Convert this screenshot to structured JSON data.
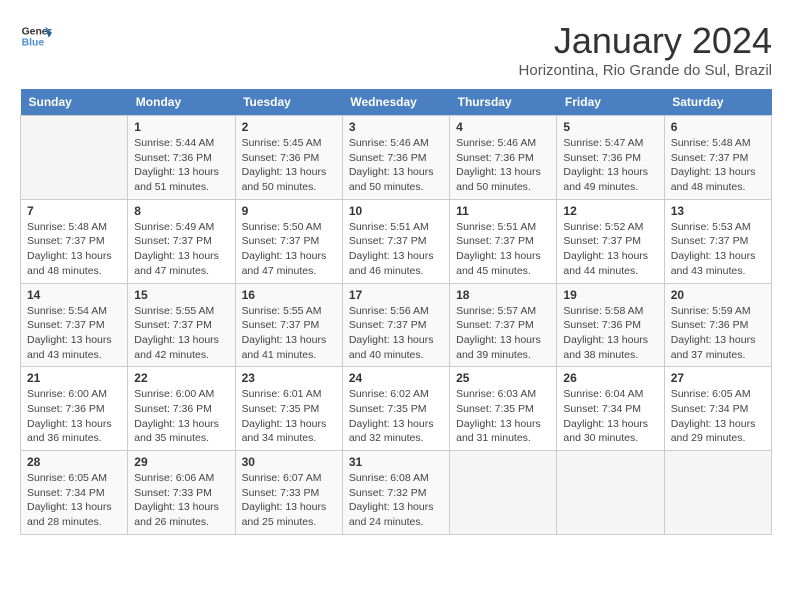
{
  "header": {
    "logo_line1": "General",
    "logo_line2": "Blue",
    "month": "January 2024",
    "location": "Horizontina, Rio Grande do Sul, Brazil"
  },
  "weekdays": [
    "Sunday",
    "Monday",
    "Tuesday",
    "Wednesday",
    "Thursday",
    "Friday",
    "Saturday"
  ],
  "weeks": [
    [
      {
        "day": "",
        "sunrise": "",
        "sunset": "",
        "daylight": ""
      },
      {
        "day": "1",
        "sunrise": "Sunrise: 5:44 AM",
        "sunset": "Sunset: 7:36 PM",
        "daylight": "Daylight: 13 hours and 51 minutes."
      },
      {
        "day": "2",
        "sunrise": "Sunrise: 5:45 AM",
        "sunset": "Sunset: 7:36 PM",
        "daylight": "Daylight: 13 hours and 50 minutes."
      },
      {
        "day": "3",
        "sunrise": "Sunrise: 5:46 AM",
        "sunset": "Sunset: 7:36 PM",
        "daylight": "Daylight: 13 hours and 50 minutes."
      },
      {
        "day": "4",
        "sunrise": "Sunrise: 5:46 AM",
        "sunset": "Sunset: 7:36 PM",
        "daylight": "Daylight: 13 hours and 50 minutes."
      },
      {
        "day": "5",
        "sunrise": "Sunrise: 5:47 AM",
        "sunset": "Sunset: 7:36 PM",
        "daylight": "Daylight: 13 hours and 49 minutes."
      },
      {
        "day": "6",
        "sunrise": "Sunrise: 5:48 AM",
        "sunset": "Sunset: 7:37 PM",
        "daylight": "Daylight: 13 hours and 48 minutes."
      }
    ],
    [
      {
        "day": "7",
        "sunrise": "Sunrise: 5:48 AM",
        "sunset": "Sunset: 7:37 PM",
        "daylight": "Daylight: 13 hours and 48 minutes."
      },
      {
        "day": "8",
        "sunrise": "Sunrise: 5:49 AM",
        "sunset": "Sunset: 7:37 PM",
        "daylight": "Daylight: 13 hours and 47 minutes."
      },
      {
        "day": "9",
        "sunrise": "Sunrise: 5:50 AM",
        "sunset": "Sunset: 7:37 PM",
        "daylight": "Daylight: 13 hours and 47 minutes."
      },
      {
        "day": "10",
        "sunrise": "Sunrise: 5:51 AM",
        "sunset": "Sunset: 7:37 PM",
        "daylight": "Daylight: 13 hours and 46 minutes."
      },
      {
        "day": "11",
        "sunrise": "Sunrise: 5:51 AM",
        "sunset": "Sunset: 7:37 PM",
        "daylight": "Daylight: 13 hours and 45 minutes."
      },
      {
        "day": "12",
        "sunrise": "Sunrise: 5:52 AM",
        "sunset": "Sunset: 7:37 PM",
        "daylight": "Daylight: 13 hours and 44 minutes."
      },
      {
        "day": "13",
        "sunrise": "Sunrise: 5:53 AM",
        "sunset": "Sunset: 7:37 PM",
        "daylight": "Daylight: 13 hours and 43 minutes."
      }
    ],
    [
      {
        "day": "14",
        "sunrise": "Sunrise: 5:54 AM",
        "sunset": "Sunset: 7:37 PM",
        "daylight": "Daylight: 13 hours and 43 minutes."
      },
      {
        "day": "15",
        "sunrise": "Sunrise: 5:55 AM",
        "sunset": "Sunset: 7:37 PM",
        "daylight": "Daylight: 13 hours and 42 minutes."
      },
      {
        "day": "16",
        "sunrise": "Sunrise: 5:55 AM",
        "sunset": "Sunset: 7:37 PM",
        "daylight": "Daylight: 13 hours and 41 minutes."
      },
      {
        "day": "17",
        "sunrise": "Sunrise: 5:56 AM",
        "sunset": "Sunset: 7:37 PM",
        "daylight": "Daylight: 13 hours and 40 minutes."
      },
      {
        "day": "18",
        "sunrise": "Sunrise: 5:57 AM",
        "sunset": "Sunset: 7:37 PM",
        "daylight": "Daylight: 13 hours and 39 minutes."
      },
      {
        "day": "19",
        "sunrise": "Sunrise: 5:58 AM",
        "sunset": "Sunset: 7:36 PM",
        "daylight": "Daylight: 13 hours and 38 minutes."
      },
      {
        "day": "20",
        "sunrise": "Sunrise: 5:59 AM",
        "sunset": "Sunset: 7:36 PM",
        "daylight": "Daylight: 13 hours and 37 minutes."
      }
    ],
    [
      {
        "day": "21",
        "sunrise": "Sunrise: 6:00 AM",
        "sunset": "Sunset: 7:36 PM",
        "daylight": "Daylight: 13 hours and 36 minutes."
      },
      {
        "day": "22",
        "sunrise": "Sunrise: 6:00 AM",
        "sunset": "Sunset: 7:36 PM",
        "daylight": "Daylight: 13 hours and 35 minutes."
      },
      {
        "day": "23",
        "sunrise": "Sunrise: 6:01 AM",
        "sunset": "Sunset: 7:35 PM",
        "daylight": "Daylight: 13 hours and 34 minutes."
      },
      {
        "day": "24",
        "sunrise": "Sunrise: 6:02 AM",
        "sunset": "Sunset: 7:35 PM",
        "daylight": "Daylight: 13 hours and 32 minutes."
      },
      {
        "day": "25",
        "sunrise": "Sunrise: 6:03 AM",
        "sunset": "Sunset: 7:35 PM",
        "daylight": "Daylight: 13 hours and 31 minutes."
      },
      {
        "day": "26",
        "sunrise": "Sunrise: 6:04 AM",
        "sunset": "Sunset: 7:34 PM",
        "daylight": "Daylight: 13 hours and 30 minutes."
      },
      {
        "day": "27",
        "sunrise": "Sunrise: 6:05 AM",
        "sunset": "Sunset: 7:34 PM",
        "daylight": "Daylight: 13 hours and 29 minutes."
      }
    ],
    [
      {
        "day": "28",
        "sunrise": "Sunrise: 6:05 AM",
        "sunset": "Sunset: 7:34 PM",
        "daylight": "Daylight: 13 hours and 28 minutes."
      },
      {
        "day": "29",
        "sunrise": "Sunrise: 6:06 AM",
        "sunset": "Sunset: 7:33 PM",
        "daylight": "Daylight: 13 hours and 26 minutes."
      },
      {
        "day": "30",
        "sunrise": "Sunrise: 6:07 AM",
        "sunset": "Sunset: 7:33 PM",
        "daylight": "Daylight: 13 hours and 25 minutes."
      },
      {
        "day": "31",
        "sunrise": "Sunrise: 6:08 AM",
        "sunset": "Sunset: 7:32 PM",
        "daylight": "Daylight: 13 hours and 24 minutes."
      },
      {
        "day": "",
        "sunrise": "",
        "sunset": "",
        "daylight": ""
      },
      {
        "day": "",
        "sunrise": "",
        "sunset": "",
        "daylight": ""
      },
      {
        "day": "",
        "sunrise": "",
        "sunset": "",
        "daylight": ""
      }
    ]
  ]
}
